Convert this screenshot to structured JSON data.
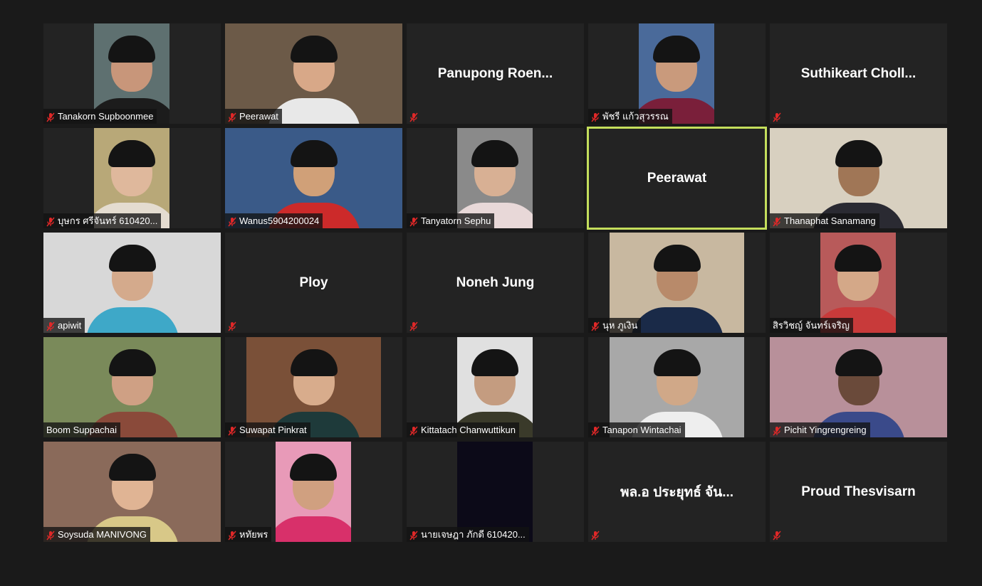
{
  "window": {
    "background": "#1a1a1a",
    "active_speaker_color": "#c4de5c"
  },
  "participants": [
    {
      "name": "Tanakorn Supboonmee",
      "muted": true,
      "video": true,
      "bg": "#5e7070",
      "skin": "#c8967a",
      "shirt": "#1c1c1c",
      "frame": "center"
    },
    {
      "name": "Peerawat",
      "muted": true,
      "video": true,
      "bg": "#6c5a48",
      "skin": "#d8a888",
      "shirt": "#e8e8e8",
      "frame": "full"
    },
    {
      "name": "Panupong Roen...",
      "muted": true,
      "video": false
    },
    {
      "name": "พัชรี แก้วสุวรรณ",
      "muted": true,
      "video": true,
      "bg": "#4a6a9a",
      "skin": "#c99a7c",
      "shirt": "#7a1f3a",
      "frame": "center"
    },
    {
      "name": "Suthikeart  Choll...",
      "muted": true,
      "video": false
    },
    {
      "name": "บุษกร ศรีจันทร์ 610420...",
      "muted": true,
      "video": true,
      "bg": "#b8a878",
      "skin": "#dfb89c",
      "shirt": "#e4dcd0",
      "frame": "center"
    },
    {
      "name": "Wanus5904200024",
      "muted": true,
      "video": true,
      "bg": "#3a5a88",
      "skin": "#d0a078",
      "shirt": "#cc2a2a",
      "frame": "full"
    },
    {
      "name": "Tanyatorn Sephu",
      "muted": true,
      "video": true,
      "bg": "#8a8a8a",
      "skin": "#d8b094",
      "shirt": "#e8d8d8",
      "frame": "center"
    },
    {
      "name": "Peerawat",
      "muted": false,
      "video": false,
      "active": true
    },
    {
      "name": "Thanaphat Sanamang",
      "muted": true,
      "video": true,
      "bg": "#d8d0c0",
      "skin": "#a07656",
      "shirt": "#2a2a32",
      "frame": "full"
    },
    {
      "name": "apiwit",
      "muted": true,
      "video": true,
      "bg": "#d8d8d8",
      "skin": "#d4aa8c",
      "shirt": "#3ea8c8",
      "frame": "full"
    },
    {
      "name": "Ploy",
      "muted": true,
      "video": false
    },
    {
      "name": "Noneh Jung",
      "muted": true,
      "video": false
    },
    {
      "name": "นุห ภูเงิน",
      "muted": true,
      "video": true,
      "bg": "#c8b8a0",
      "skin": "#b88a6a",
      "shirt": "#1a2a48",
      "frame": "wide"
    },
    {
      "name": "สิรวิชญ์ จันทร์เจริญ",
      "muted": false,
      "video": true,
      "bg": "#b85a5a",
      "skin": "#d4a888",
      "shirt": "#c83a3a",
      "frame": "center"
    },
    {
      "name": "Boom Suppachai",
      "muted": false,
      "video": true,
      "bg": "#7a8a5a",
      "skin": "#cfa084",
      "shirt": "#8a4a3a",
      "frame": "full"
    },
    {
      "name": "Suwapat Pinkrat",
      "muted": true,
      "video": true,
      "bg": "#7a5038",
      "skin": "#d8ac8c",
      "shirt": "#1e3a3a",
      "frame": "wide"
    },
    {
      "name": "Kittatach Chanwuttikun",
      "muted": true,
      "video": true,
      "bg": "#e0e0e0",
      "skin": "#c49c80",
      "shirt": "#3a3a2a",
      "frame": "center"
    },
    {
      "name": "Tanapon Wintachai",
      "muted": true,
      "video": true,
      "bg": "#a8a8a8",
      "skin": "#d0a888",
      "shirt": "#eeeeee",
      "frame": "wide"
    },
    {
      "name": "Pichit Yingrengreing",
      "muted": true,
      "video": true,
      "bg": "#b8909a",
      "skin": "#6a4a3a",
      "shirt": "#3a4a8a",
      "frame": "full"
    },
    {
      "name": "Soysuda MANIVONG",
      "muted": true,
      "video": true,
      "bg": "#8a6a5a",
      "skin": "#e0b494",
      "shirt": "#d8c888",
      "frame": "full"
    },
    {
      "name": "หทัยพร",
      "muted": true,
      "video": true,
      "bg": "#e89ab8",
      "skin": "#d0a080",
      "shirt": "#d8306a",
      "frame": "center"
    },
    {
      "name": "นายเจษฎา ภักดี 610420...",
      "muted": true,
      "video": true,
      "bg": "#0c0a18",
      "skin": "#0c0a18",
      "shirt": "#0c0a18",
      "frame": "center",
      "dark": true
    },
    {
      "name": "พล.อ ประยุทธ์ จัน...",
      "muted": true,
      "video": false
    },
    {
      "name": "Proud Thesvisarn",
      "muted": true,
      "video": false
    }
  ]
}
